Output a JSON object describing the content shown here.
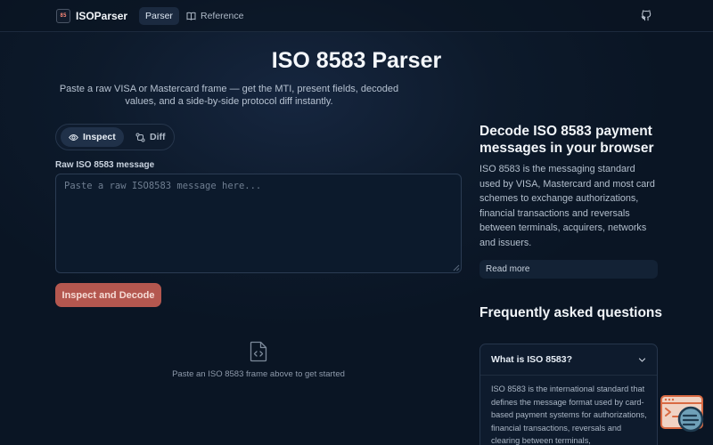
{
  "nav": {
    "logo_text": "85",
    "brand": "ISOParser",
    "tabs": [
      {
        "label": "Parser",
        "active": true
      },
      {
        "label": "Reference",
        "active": false
      }
    ],
    "icons": {
      "reference": "book-icon",
      "github": "github-icon"
    }
  },
  "hero": {
    "title": "ISO 8583 Parser",
    "subtitle": "Paste a raw VISA or Mastercard frame — get the MTI, present fields, decoded values, and a side-by-side protocol diff instantly."
  },
  "mode_toggle": {
    "inspect_label": "Inspect",
    "diff_label": "Diff",
    "selected": "Inspect"
  },
  "input": {
    "label": "Raw ISO 8583 message",
    "value": "",
    "placeholder": "Paste a raw ISO8583 message here..."
  },
  "submit_label": "Inspect and Decode",
  "empty_state": {
    "icon": "file-code-icon",
    "text": "Paste an ISO 8583 frame above to get started"
  },
  "sidebar": {
    "about_heading": "Decode ISO 8583 payment messages in your browser",
    "about_text": "ISO 8583 is the messaging standard used by VISA, Mastercard and most card schemes to exchange authorizations, financial transactions and reversals between terminals, acquirers, networks and issuers.",
    "read_more_label": "Read more",
    "faq_heading": "Frequently asked questions",
    "faq": [
      {
        "question": "What is ISO 8583?",
        "answer": "ISO 8583 is the international standard that defines the message format used by card-based payment systems for authorizations, financial transactions, reversals and clearing between terminals,",
        "expanded": true
      }
    ]
  },
  "colors": {
    "background": "#0d1a2b",
    "accent": "#b4574f",
    "panel": "#0e1b2d",
    "text": "#e6edf5"
  }
}
